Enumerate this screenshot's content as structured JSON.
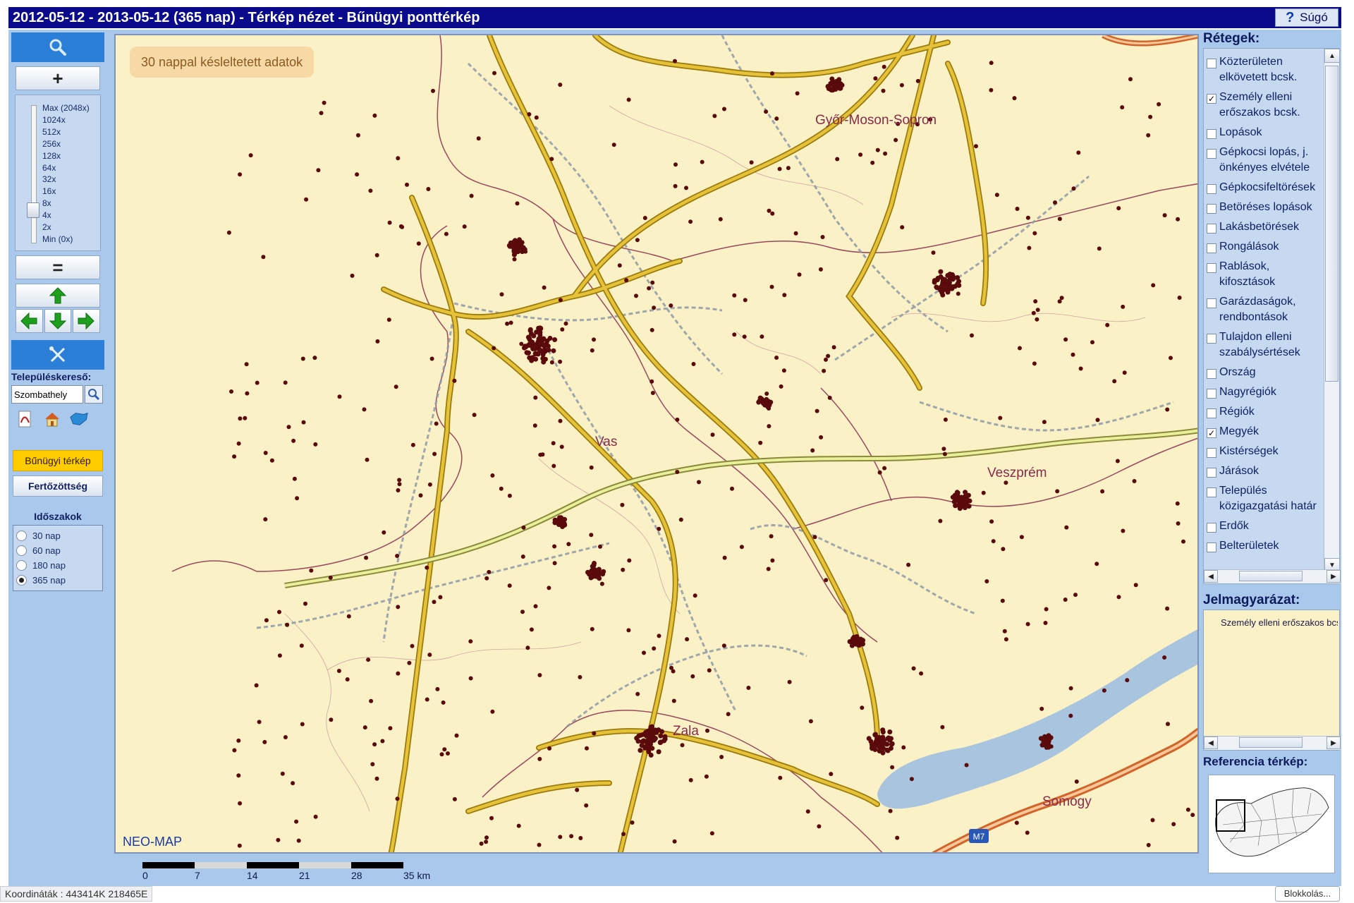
{
  "title": "2012-05-12 - 2013-05-12 (365 nap) - Térkép nézet - Bűnügyi ponttérkép",
  "help": {
    "label": "Súgó",
    "icon": "question-icon"
  },
  "colors": {
    "title_bg": "#0a0a8c",
    "panel_bg": "#a9c8ec",
    "accent_blue": "#2c7fd6",
    "active_yellow": "#ffcc00",
    "map_bg": "#fbf1c7",
    "road": "#d4b21a",
    "crime_dot": "#5a0a0a",
    "lake": "#a9c4de"
  },
  "left_panel": {
    "search_icon": "magnifier-icon",
    "zoom_in_label": "+",
    "zoom_out_label": "=",
    "zoom_levels": [
      "Max (2048x)",
      "1024x",
      "512x",
      "256x",
      "128x",
      "64x",
      "32x",
      "16x",
      "8x",
      "4x",
      "2x",
      "Min (0x)"
    ],
    "tools_icon": "wrench-screwdriver-icon",
    "place_search_label": "Településkereső:",
    "place_search_value": "Szombathely",
    "mode_crime": "Bűnügyi térkép",
    "mode_infect": "Fertőzöttség",
    "periods_title": "Időszakok",
    "periods": [
      {
        "label": "30 nap",
        "selected": false
      },
      {
        "label": "60 nap",
        "selected": false
      },
      {
        "label": "180 nap",
        "selected": false
      },
      {
        "label": "365 nap",
        "selected": true
      }
    ]
  },
  "map": {
    "delay_banner": "30 nappal késleltetett adatok",
    "brand": "NEO-MAP",
    "labels": {
      "gyor": "Győr-Moson-Sopron",
      "vas": "Vas",
      "veszprem": "Veszprém",
      "zala": "Zala",
      "somogy": "Somogy",
      "m7": "M7"
    }
  },
  "scalebar": {
    "labels": [
      "0",
      "7",
      "14",
      "21",
      "28",
      "35 km"
    ]
  },
  "right_panel": {
    "layers_title": "Rétegek:",
    "layers": [
      {
        "label": "Közterületen elkövetett bcsk.",
        "checked": false
      },
      {
        "label": "Személy elleni erőszakos bcsk.",
        "checked": true
      },
      {
        "label": "Lopások",
        "checked": false
      },
      {
        "label": "Gépkocsi lopás, j. önkényes elvétele",
        "checked": false
      },
      {
        "label": "Gépkocsifeltörések",
        "checked": false
      },
      {
        "label": "Betöréses lopások",
        "checked": false
      },
      {
        "label": "Lakásbetörések",
        "checked": false
      },
      {
        "label": "Rongálások",
        "checked": false
      },
      {
        "label": "Rablások, kifosztások",
        "checked": false
      },
      {
        "label": "Garázdaságok, rendbontások",
        "checked": false
      },
      {
        "label": "Tulajdon elleni szabálysértések",
        "checked": false
      },
      {
        "label": "Ország",
        "checked": false
      },
      {
        "label": "Nagyrégiók",
        "checked": false
      },
      {
        "label": "Régiók",
        "checked": false
      },
      {
        "label": "Megyék",
        "checked": true
      },
      {
        "label": "Kistérségek",
        "checked": false
      },
      {
        "label": "Járások",
        "checked": false
      },
      {
        "label": "Település közigazgatási határ",
        "checked": false
      },
      {
        "label": "Erdők",
        "checked": false
      },
      {
        "label": "Belterületek",
        "checked": false
      }
    ],
    "legend_title": "Jelmagyarázat:",
    "legend_item": "Személy elleni erőszakos bcsk.",
    "reference_title": "Referencia térkép:"
  },
  "status": {
    "coordinates": "Koordináták : 443414K 218465E",
    "block_button": "Blokkolás..."
  }
}
